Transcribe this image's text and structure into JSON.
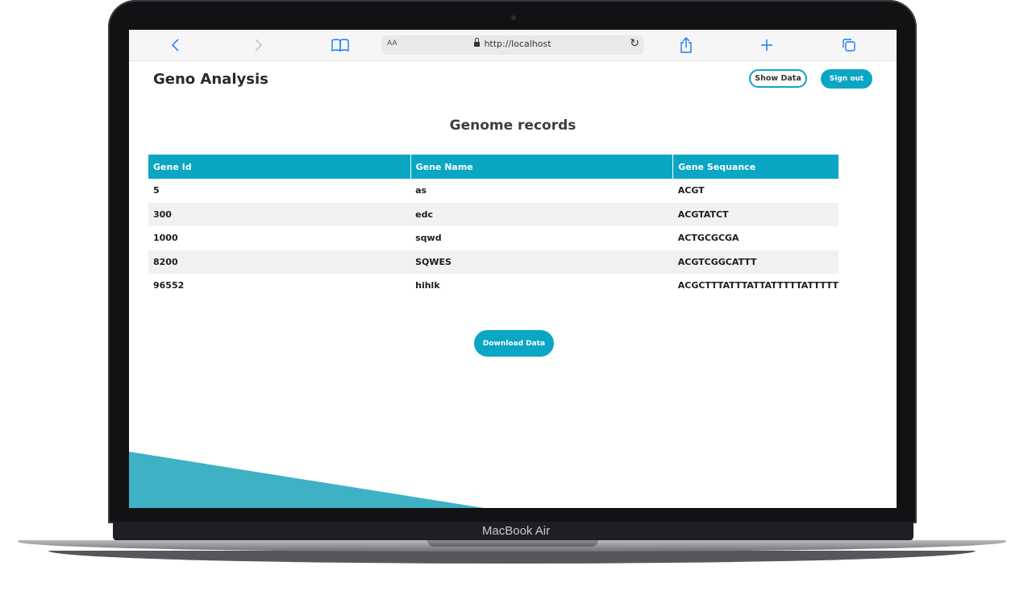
{
  "device": {
    "brand": "MacBook Air"
  },
  "browser": {
    "text_size_label": "AA",
    "url": "http://localhost"
  },
  "header": {
    "app_title": "Geno Analysis",
    "show_data_label": "Show Data",
    "sign_out_label": "Sign out"
  },
  "main": {
    "title": "Genome records",
    "table": {
      "columns": [
        "Gene Id",
        "Gene Name",
        "Gene Sequance"
      ],
      "rows": [
        [
          "5",
          "as",
          "ACGT"
        ],
        [
          "300",
          "edc",
          "ACGTATCT"
        ],
        [
          "1000",
          "sqwd",
          "ACTGCGCGA"
        ],
        [
          "8200",
          "SQWES",
          "ACGTCGGCATTT"
        ],
        [
          "96552",
          "hihlk",
          "ACGCTTTATTTATTATTTTTATTTTT"
        ]
      ]
    },
    "download_label": "Download Data"
  },
  "colors": {
    "accent": "#0aa6c4",
    "decor": "#3fb1c5"
  }
}
